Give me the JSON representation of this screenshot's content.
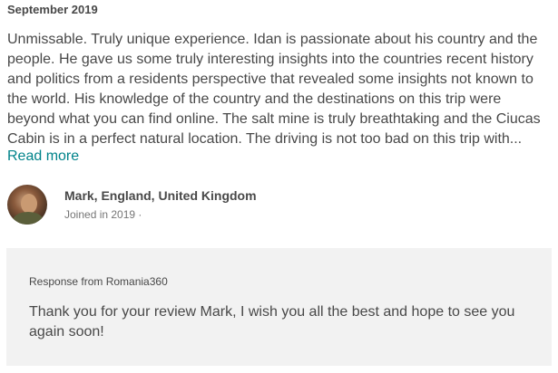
{
  "review": {
    "date": "September 2019",
    "text": "Unmissable. Truly unique experience. Idan is passionate about his country and the people. He gave us some truly interesting insights into the countries recent history and politics from a residents perspective that revealed some insights not known to the world. His knowledge of the country and the destinations on this trip were beyond what you can find online. The salt mine is truly breathtaking and the Ciucas Cabin is in a perfect natural location. The driving is not too bad on this trip with...",
    "read_more_label": "Read more"
  },
  "reviewer": {
    "name": "Mark, England, United Kingdom",
    "joined": "Joined in 2019 ·"
  },
  "response": {
    "label": "Response from Romania360",
    "text": "Thank you for your review Mark, I wish you all the best and hope to see you again soon!"
  },
  "colors": {
    "link": "#00838a",
    "response_bg": "#f2f2f2",
    "text": "#484848"
  }
}
